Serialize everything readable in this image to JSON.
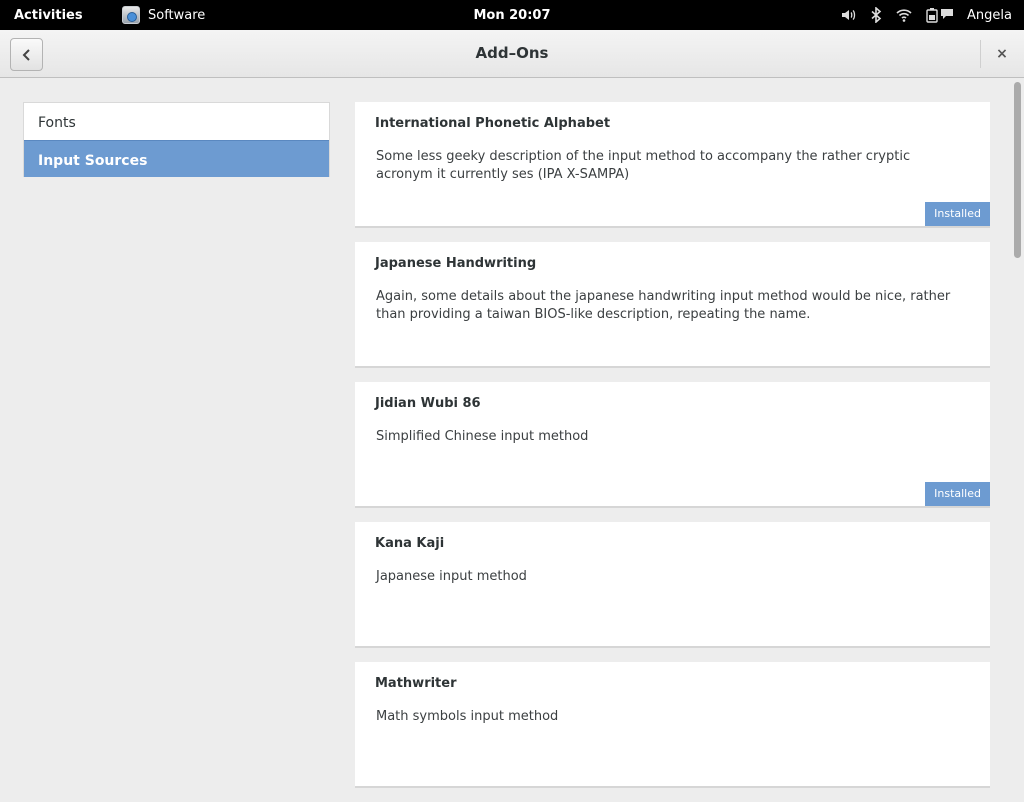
{
  "top_bar": {
    "activities": "Activities",
    "app_name": "Software",
    "clock": "Mon 20:07",
    "user": "Angela",
    "tray_icons": [
      "volume-icon",
      "bluetooth-icon",
      "wifi-icon",
      "battery-icon",
      "chat-icon"
    ]
  },
  "header": {
    "title": "Add–Ons",
    "close_label": "×"
  },
  "sidebar": {
    "items": [
      {
        "label": "Fonts",
        "selected": false
      },
      {
        "label": "Input Sources",
        "selected": true
      }
    ]
  },
  "addons": [
    {
      "name": "International Phonetic Alphabet",
      "description": "Some less geeky description of the input method to accompany the rather cryptic acronym it currently ses (IPA X-SAMPA)",
      "badge": "Installed"
    },
    {
      "name": "Japanese Handwriting",
      "description": "Again, some details about the japanese handwriting input method would be nice, rather than providing a taiwan BIOS-like description, repeating the name.",
      "badge": ""
    },
    {
      "name": "Jidian Wubi 86",
      "description": "Simplified Chinese input method",
      "badge": "Installed"
    },
    {
      "name": "Kana Kaji",
      "description": "Japanese input method",
      "badge": ""
    },
    {
      "name": "Mathwriter",
      "description": "Math symbols input method",
      "badge": ""
    }
  ],
  "colors": {
    "accent": "#6d9bd1",
    "top_bar": "#000000",
    "background": "#ededed"
  }
}
